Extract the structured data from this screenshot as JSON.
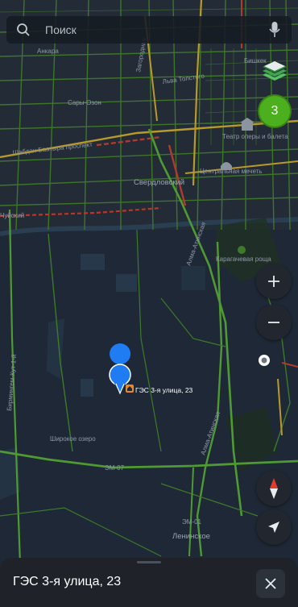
{
  "search": {
    "placeholder": "Поиск"
  },
  "traffic_badge": {
    "value": "3",
    "color": "#4caf1d"
  },
  "map": {
    "labels": {
      "ankara": "Анкара",
      "bishkek": "Бишкек",
      "lva_tolstogo": "Льва Толстого",
      "sary_ozon": "Сары-Озон",
      "shabdan": "Шабдан Баатыра проспект",
      "sverdlovsky": "Свердловский",
      "central_mosque": "Центральная мечеть",
      "theatre": "Театр оперы и балета",
      "karagachevaya": "Карагачевая роща",
      "alma_ata": "Алма-Атинская",
      "alma_ata2": "Алма-Атинская",
      "birmingem": "Бирмингем-Кут-1-й",
      "shirokoe": "Широкое озеро",
      "em07": "ЭМ-07",
      "em01": "ЭМ-01",
      "leninskoe": "Ленинское",
      "chuy": "Чуйский",
      "zagorod": "Загородная"
    },
    "marker_label": "ГЭС 3-я улица, 23"
  },
  "controls": {
    "zoom_in": "+",
    "zoom_out": "−",
    "icons": [
      "layers-icon",
      "zoom-in-icon",
      "zoom-out-icon",
      "location-dot-icon",
      "compass-icon",
      "navigation-arrow-icon"
    ]
  },
  "bottom_sheet": {
    "title": "ГЭС 3-я улица, 23"
  },
  "colors": {
    "map_bg": "#1e2836",
    "road_green": "#4f9a32",
    "road_yellow": "#b89a2a",
    "road_red": "#b23a2c",
    "marker_blue": "#1f7cf2",
    "poi_orange": "#e98a2a"
  }
}
